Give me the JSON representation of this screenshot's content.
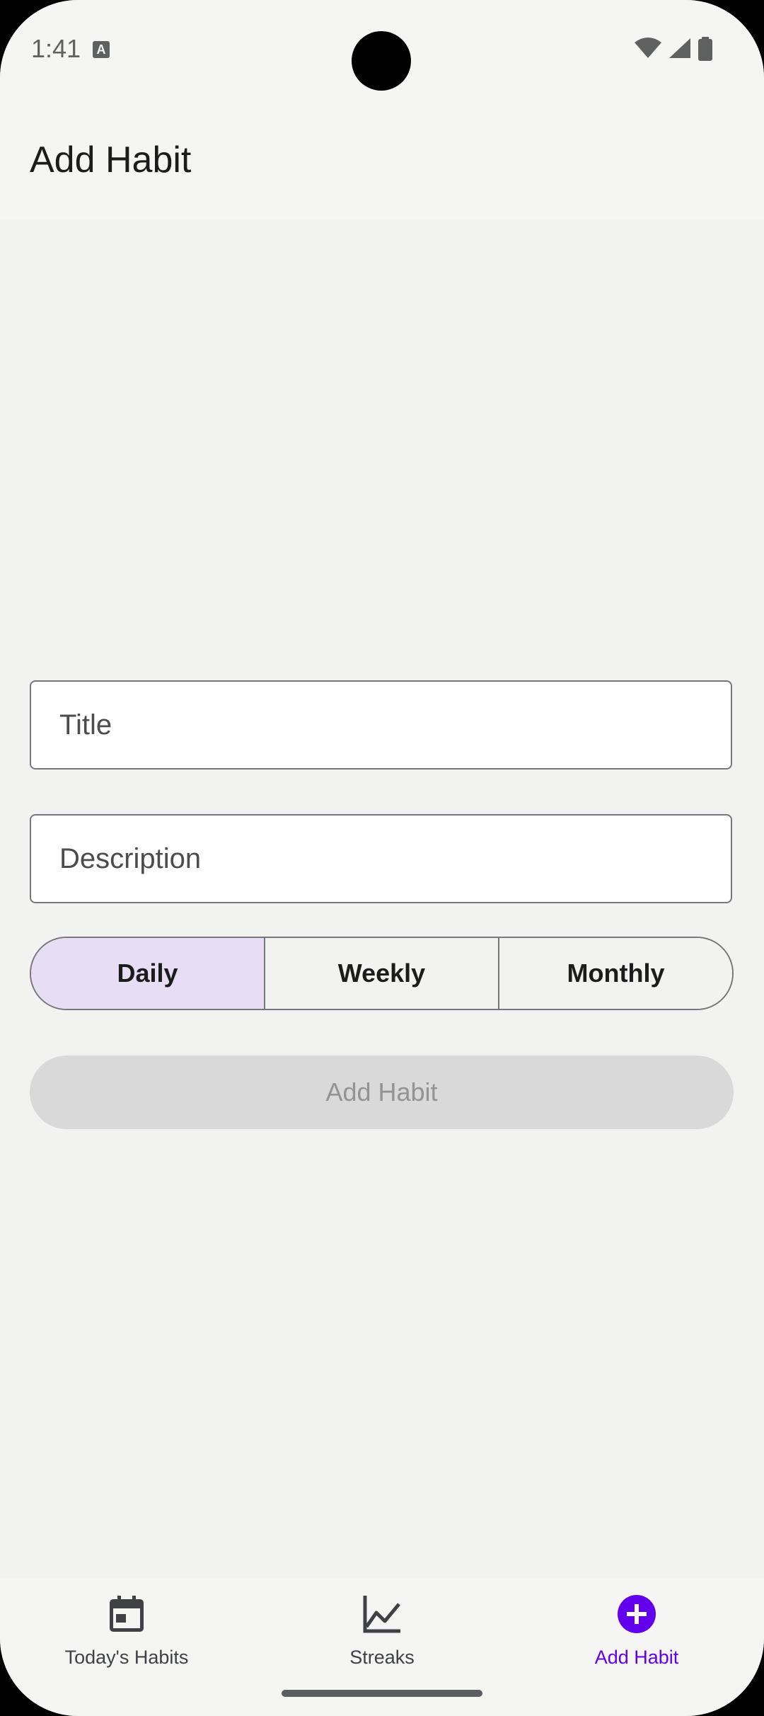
{
  "status_bar": {
    "time": "1:41",
    "notification_icon": "text-a-icon",
    "icons": [
      "wifi-icon",
      "cell-signal-icon",
      "battery-icon"
    ]
  },
  "app_bar": {
    "title": "Add Habit"
  },
  "form": {
    "title_field": {
      "placeholder": "Title",
      "value": ""
    },
    "description_field": {
      "placeholder": "Description",
      "value": ""
    },
    "frequency": {
      "options": [
        "Daily",
        "Weekly",
        "Monthly"
      ],
      "selected": "Daily"
    },
    "submit_label": "Add Habit",
    "submit_enabled": false
  },
  "bottom_nav": {
    "items": [
      {
        "label": "Today's Habits",
        "icon": "calendar-icon",
        "active": false
      },
      {
        "label": "Streaks",
        "icon": "line-chart-icon",
        "active": false
      },
      {
        "label": "Add Habit",
        "icon": "add-circle-icon",
        "active": true
      }
    ]
  },
  "colors": {
    "accent": "#6200ee",
    "selected_segment": "#e7def6",
    "background": "#f2f3f1",
    "disabled_button": "#d9d9d9"
  }
}
